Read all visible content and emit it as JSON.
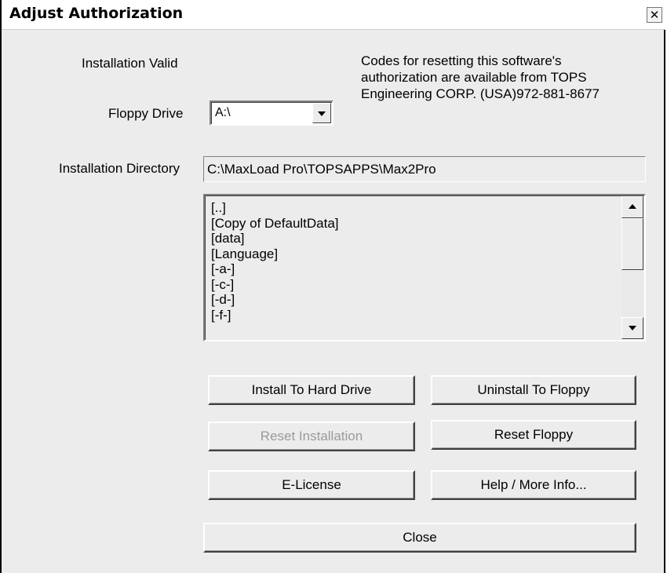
{
  "window": {
    "title": "Adjust Authorization",
    "close_glyph": "✕"
  },
  "status": {
    "text": "Installation Valid"
  },
  "info": {
    "line1": "Codes for resetting this software's",
    "line2": "authorization are available from TOPS",
    "line3": "Engineering CORP. (USA)972-881-8677"
  },
  "floppy": {
    "label": "Floppy Drive",
    "selected": "A:\\",
    "icon": "chevron-down-icon"
  },
  "directory": {
    "label": "Installation Directory",
    "value": "C:\\MaxLoad Pro\\TOPSAPPS\\Max2Pro"
  },
  "folder_list": {
    "items": [
      "[..]",
      "[Copy of DefaultData]",
      "[data]",
      "[Language]",
      "[-a-]",
      "[-c-]",
      "[-d-]",
      "[-f-]"
    ]
  },
  "buttons": {
    "install_hd": "Install To Hard Drive",
    "uninstall_floppy": "Uninstall To Floppy",
    "reset_installation": "Reset Installation",
    "reset_floppy": "Reset Floppy",
    "e_license": "E-License",
    "help": "Help / More Info...",
    "close": "Close"
  }
}
